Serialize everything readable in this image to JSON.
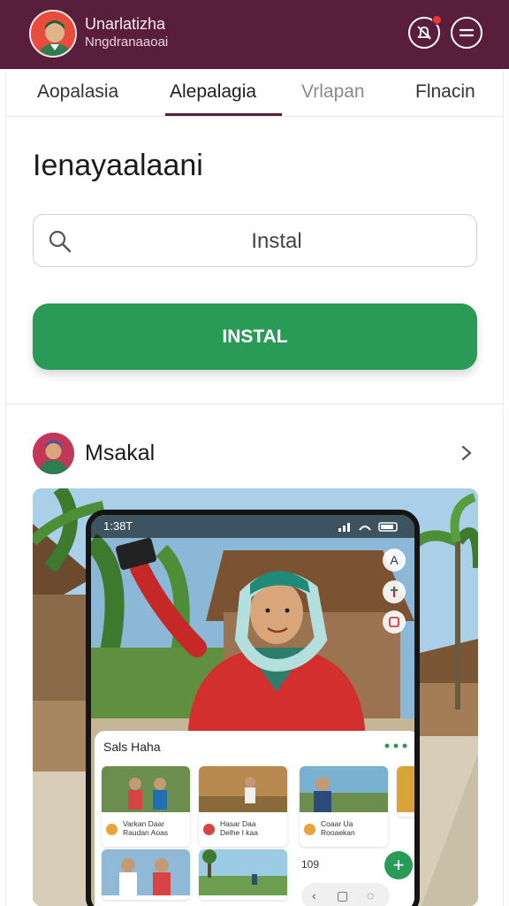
{
  "header": {
    "title_line1": "Unarlatizha",
    "title_line2": "Nngdranaaoai",
    "notification_icon": "notification-bell-icon",
    "menu_icon": "menu-icon",
    "brand_color": "#5a1e3d",
    "notification_color": "#e53935"
  },
  "tabs": [
    {
      "label": "Aopalasia",
      "state": "normal"
    },
    {
      "label": "Alepalagia",
      "state": "active"
    },
    {
      "label": "Vrlapan",
      "state": "muted"
    },
    {
      "label": "Flnacin",
      "state": "normal"
    }
  ],
  "main": {
    "title": "Ienayaalaani",
    "search": {
      "placeholder": "Instal",
      "value": ""
    },
    "install_label": "INSTAL",
    "accent_color": "#2a9a57"
  },
  "post": {
    "author": "Msakal",
    "phone": {
      "time": "1:38T",
      "sheet_title": "Sals Haha",
      "sheet_count": "109",
      "thumbnails": [
        {
          "line1": "Varkan Daar",
          "line2": "Raudan Aoas"
        },
        {
          "line1": "Hasar Daa",
          "line2": "Delhe I kaa"
        },
        {
          "line1": "Coaar Ua",
          "line2": "Rooaekan"
        }
      ]
    }
  }
}
